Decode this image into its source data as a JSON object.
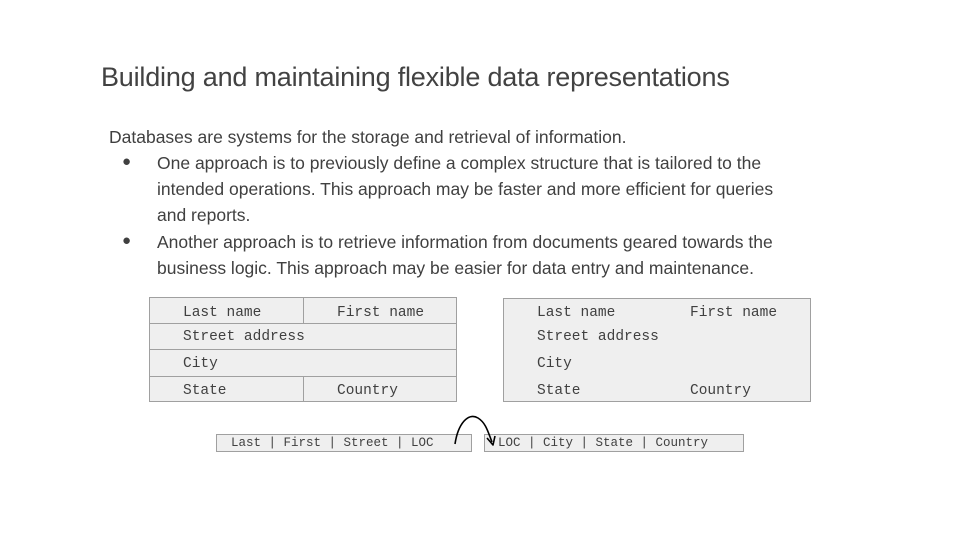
{
  "title": "Building and maintaining flexible data representations",
  "intro": "Databases are systems for the storage and retrieval of information.",
  "bullets": [
    {
      "lines": [
        "One approach is to previously define a complex structure that is tailored to the",
        "intended operations. This approach may be faster and more efficient for queries",
        "and reports."
      ]
    },
    {
      "lines": [
        "Another approach is to retrieve information from documents geared towards the",
        "business logic. This approach may be easier for data entry and maintenance."
      ]
    }
  ],
  "structured_record": {
    "last_name": "Last name",
    "first_name": "First name",
    "street": "Street address",
    "city": "City",
    "state": "State",
    "country": "Country"
  },
  "document_record": {
    "last_name": "Last name",
    "first_name": "First name",
    "street": "Street address",
    "city": "City",
    "state": "State",
    "country": "Country"
  },
  "strips": {
    "left": "Last | First | Street | LOC",
    "right": "LOC | City | State | Country"
  }
}
